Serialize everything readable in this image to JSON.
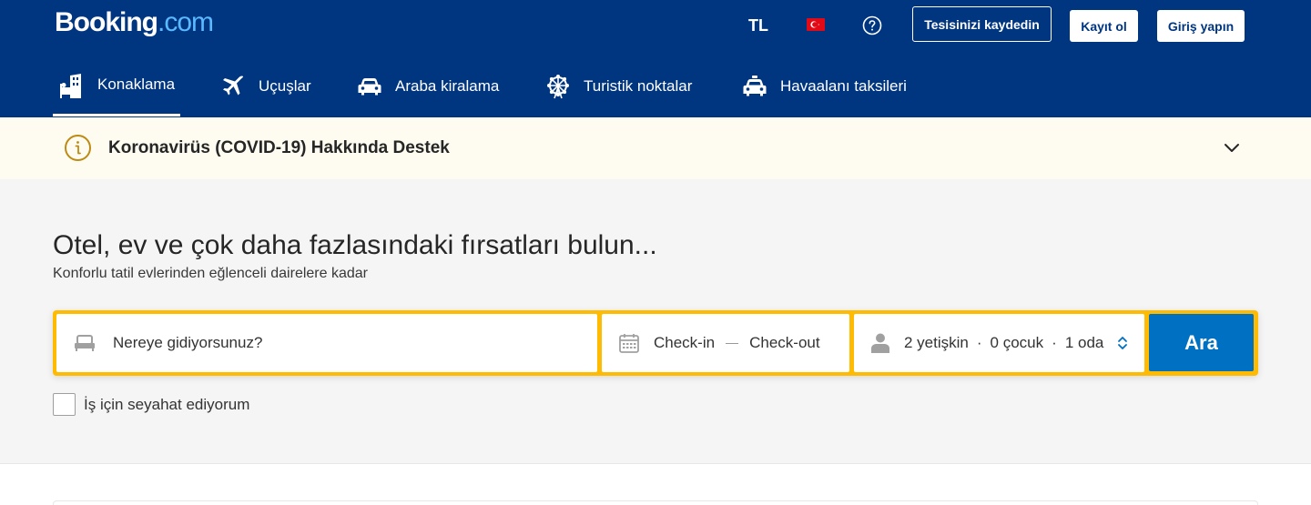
{
  "header": {
    "logo_main": "Booking",
    "logo_suffix": ".com",
    "currency": "TL",
    "flag": "turkey-flag-icon",
    "help_icon": "question-circle-icon",
    "list_property_label": "Tesisinizi kaydedin",
    "register_label": "Kayıt ol",
    "signin_label": "Giriş yapın",
    "bg_color": "#003580"
  },
  "nav": {
    "items": [
      {
        "label": "Konaklama",
        "icon": "bed-building-icon",
        "active": true
      },
      {
        "label": "Uçuşlar",
        "icon": "airplane-icon",
        "active": false
      },
      {
        "label": "Araba kiralama",
        "icon": "car-icon",
        "active": false
      },
      {
        "label": "Turistik noktalar",
        "icon": "ferris-wheel-icon",
        "active": false
      },
      {
        "label": "Havaalanı taksileri",
        "icon": "taxi-icon",
        "active": false
      }
    ]
  },
  "banner": {
    "text": "Koronavirüs (COVID-19) Hakkında Destek",
    "icon": "info-circle-icon",
    "expand_icon": "chevron-down-icon",
    "bg_color": "#fefbf0",
    "accent": "#bd8b13"
  },
  "search": {
    "title": "Otel, ev ve çok daha fazlasındaki fırsatları bulun...",
    "subtitle": "Konforlu tatil evlerinden eğlenceli dairelere kadar",
    "destination_placeholder": "Nereye gidiyorsunuz?",
    "checkin_label": "Check-in",
    "checkout_label": "Check-out",
    "adults": "2 yetişkin",
    "children": "0 çocuk",
    "rooms": "1 oda",
    "dot": "·",
    "search_button": "Ara",
    "business_travel_label": "İş için seyahat ediyorum",
    "border_color": "#febb02",
    "button_color": "#0071c2"
  }
}
